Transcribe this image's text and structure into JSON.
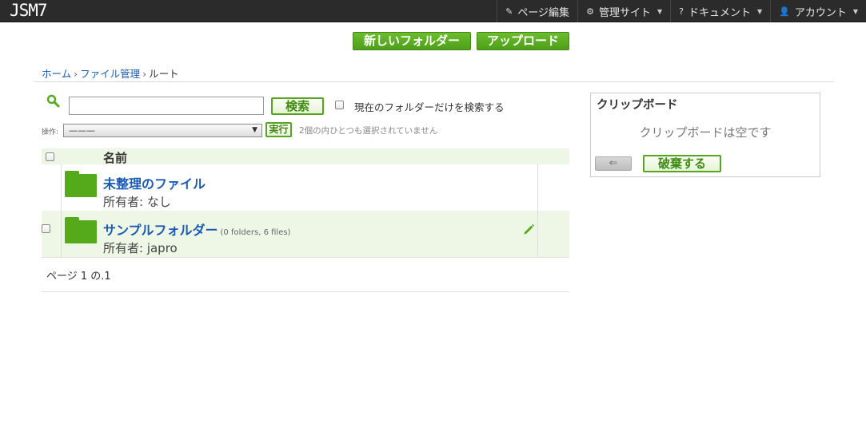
{
  "app": {
    "logo": "JSM7"
  },
  "topnav": [
    {
      "icon": "✎",
      "label": "ページ編集",
      "caret": ""
    },
    {
      "icon": "⚙",
      "label": "管理サイト",
      "caret": "▼"
    },
    {
      "icon": "?",
      "label": "ドキュメント",
      "caret": "▼"
    },
    {
      "icon": "👤",
      "label": "アカウント",
      "caret": "▼"
    }
  ],
  "actions": {
    "new_folder": "新しいフォルダー",
    "upload": "アップロード"
  },
  "breadcrumb": {
    "home": "ホーム",
    "file_mgmt": "ファイル管理",
    "current": "ルート",
    "separator": "›"
  },
  "search": {
    "value": "",
    "button": "検索",
    "current_folder_only": "現在のフォルダーだけを検索する"
  },
  "operation": {
    "label": "操作:",
    "selected": "———",
    "run_button": "実行",
    "hint": "2個の内ひとつも選択されていません"
  },
  "table": {
    "header": "名前",
    "rows": [
      {
        "name": "未整理のファイル",
        "meta": "",
        "owner": "所有者: なし"
      },
      {
        "name": "サンプルフォルダー",
        "meta": "(0 folders, 6 files)",
        "owner": "所有者: japro"
      }
    ]
  },
  "pager": "ページ 1 の.1",
  "clipboard": {
    "title": "クリップボード",
    "empty": "クリップボードは空です",
    "back": "⇐",
    "discard": "破棄する"
  },
  "colors": {
    "accent": "#55aa1c",
    "link": "#1a5bb5",
    "topbar": "#2b2b2b"
  }
}
